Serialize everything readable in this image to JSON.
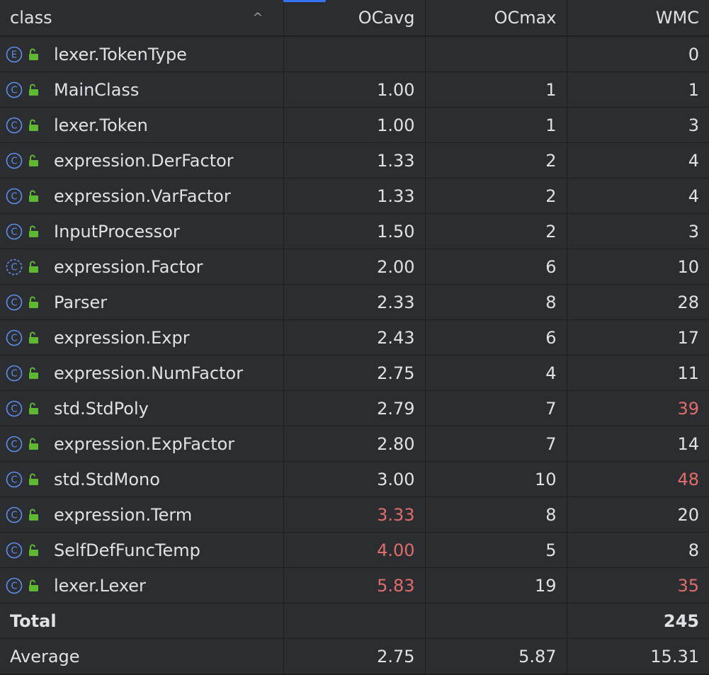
{
  "columns": {
    "class": "class",
    "ocavg": "OCavg",
    "ocmax": "OCmax",
    "wmc": "WMC"
  },
  "sort_icon": "chevron-up-icon",
  "colors": {
    "accent": "#3574f0",
    "icon_blue": "#5e8ff0",
    "lock_green": "#5fb832",
    "warning_red": "#e06c6c"
  },
  "rows": [
    {
      "name": "lexer.TokenType",
      "kind": "enum",
      "ocavg": "",
      "ocmax": "",
      "wmc": "0",
      "hot": []
    },
    {
      "name": "MainClass",
      "kind": "class",
      "ocavg": "1.00",
      "ocmax": "1",
      "wmc": "1",
      "hot": []
    },
    {
      "name": "lexer.Token",
      "kind": "class",
      "ocavg": "1.00",
      "ocmax": "1",
      "wmc": "3",
      "hot": []
    },
    {
      "name": "expression.DerFactor",
      "kind": "class",
      "ocavg": "1.33",
      "ocmax": "2",
      "wmc": "4",
      "hot": []
    },
    {
      "name": "expression.VarFactor",
      "kind": "class",
      "ocavg": "1.33",
      "ocmax": "2",
      "wmc": "4",
      "hot": []
    },
    {
      "name": "InputProcessor",
      "kind": "class",
      "ocavg": "1.50",
      "ocmax": "2",
      "wmc": "3",
      "hot": []
    },
    {
      "name": "expression.Factor",
      "kind": "abstract",
      "ocavg": "2.00",
      "ocmax": "6",
      "wmc": "10",
      "hot": []
    },
    {
      "name": "Parser",
      "kind": "class",
      "ocavg": "2.33",
      "ocmax": "8",
      "wmc": "28",
      "hot": []
    },
    {
      "name": "expression.Expr",
      "kind": "class",
      "ocavg": "2.43",
      "ocmax": "6",
      "wmc": "17",
      "hot": []
    },
    {
      "name": "expression.NumFactor",
      "kind": "class",
      "ocavg": "2.75",
      "ocmax": "4",
      "wmc": "11",
      "hot": []
    },
    {
      "name": "std.StdPoly",
      "kind": "class",
      "ocavg": "2.79",
      "ocmax": "7",
      "wmc": "39",
      "hot": [
        "wmc"
      ]
    },
    {
      "name": "expression.ExpFactor",
      "kind": "class",
      "ocavg": "2.80",
      "ocmax": "7",
      "wmc": "14",
      "hot": []
    },
    {
      "name": "std.StdMono",
      "kind": "class",
      "ocavg": "3.00",
      "ocmax": "10",
      "wmc": "48",
      "hot": [
        "wmc"
      ]
    },
    {
      "name": "expression.Term",
      "kind": "class",
      "ocavg": "3.33",
      "ocmax": "8",
      "wmc": "20",
      "hot": [
        "ocavg"
      ]
    },
    {
      "name": "SelfDefFuncTemp",
      "kind": "class",
      "ocavg": "4.00",
      "ocmax": "5",
      "wmc": "8",
      "hot": [
        "ocavg"
      ]
    },
    {
      "name": "lexer.Lexer",
      "kind": "class",
      "ocavg": "5.83",
      "ocmax": "19",
      "wmc": "35",
      "hot": [
        "ocavg",
        "wmc"
      ]
    }
  ],
  "total": {
    "label": "Total",
    "ocavg": "",
    "ocmax": "",
    "wmc": "245"
  },
  "average": {
    "label": "Average",
    "ocavg": "2.75",
    "ocmax": "5.87",
    "wmc": "15.31"
  }
}
